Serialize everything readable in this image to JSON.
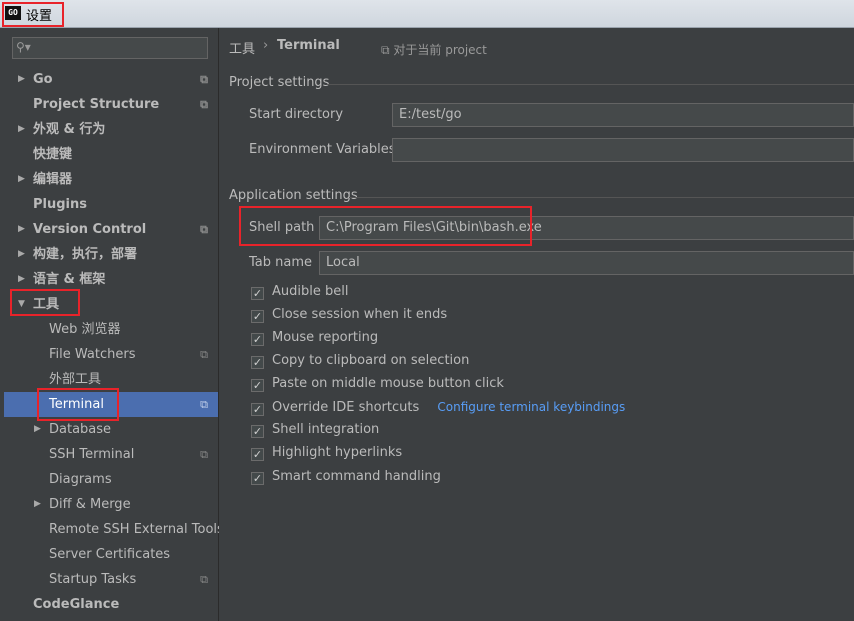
{
  "window": {
    "title": "设置",
    "app_icon_text": "GO"
  },
  "search": {
    "placeholder": ""
  },
  "tree": [
    {
      "label": "Go"
    },
    {
      "label": "Project Structure"
    },
    {
      "label": "外观 & 行为"
    },
    {
      "label": "快捷键"
    },
    {
      "label": "编辑器"
    },
    {
      "label": "Plugins"
    },
    {
      "label": "Version Control"
    },
    {
      "label": "构建，执行，部署"
    },
    {
      "label": "语言 & 框架"
    },
    {
      "label": "工具"
    },
    {
      "label": "Web 浏览器"
    },
    {
      "label": "File Watchers"
    },
    {
      "label": "外部工具"
    },
    {
      "label": "Terminal"
    },
    {
      "label": "Database"
    },
    {
      "label": "SSH Terminal"
    },
    {
      "label": "Diagrams"
    },
    {
      "label": "Diff & Merge"
    },
    {
      "label": "Remote SSH External Tools"
    },
    {
      "label": "Server Certificates"
    },
    {
      "label": "Startup Tasks"
    },
    {
      "label": "CodeGlance"
    }
  ],
  "breadcrumb": {
    "parent": "工具",
    "separator": "›",
    "current": "Terminal",
    "scope_note": "对于当前 project"
  },
  "project_settings": {
    "heading": "Project settings",
    "start_directory_label": "Start directory",
    "start_directory_value": "E:/test/go",
    "env_vars_label": "Environment Variables",
    "env_vars_value": ""
  },
  "application_settings": {
    "heading": "Application settings",
    "shell_path_label": "Shell path",
    "shell_path_value": "C:\\Program Files\\Git\\bin\\bash.exe",
    "tab_name_label": "Tab name",
    "tab_name_value": "Local",
    "checkboxes": [
      {
        "label": "Audible bell",
        "checked": true
      },
      {
        "label": "Close session when it ends",
        "checked": true
      },
      {
        "label": "Mouse reporting",
        "checked": true
      },
      {
        "label": "Copy to clipboard on selection",
        "checked": true
      },
      {
        "label": "Paste on middle mouse button click",
        "checked": true
      },
      {
        "label": "Override IDE shortcuts",
        "checked": true
      },
      {
        "label": "Shell integration",
        "checked": true
      },
      {
        "label": "Highlight hyperlinks",
        "checked": true
      },
      {
        "label": "Smart command handling",
        "checked": true
      }
    ],
    "keybindings_link": "Configure terminal keybindings"
  },
  "icons": {
    "search": "search-icon",
    "copy": "copy-icon",
    "arrow": "arrow-icon",
    "check": "checkmark-icon"
  }
}
